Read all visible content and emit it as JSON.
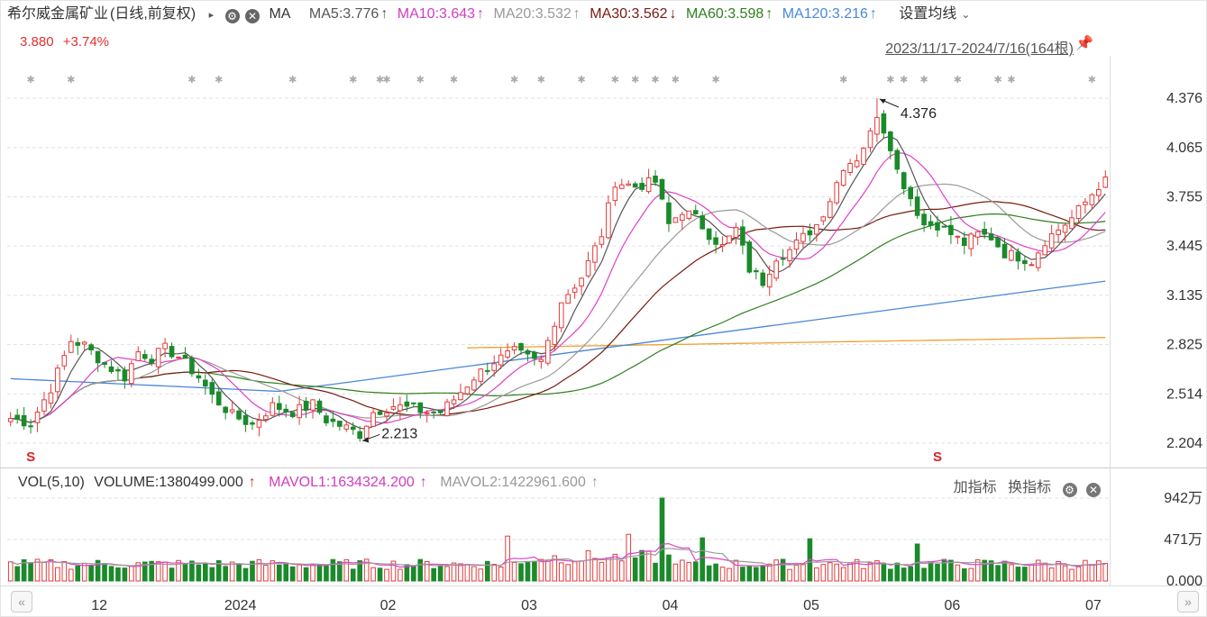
{
  "header": {
    "stock_name": "希尔威金属矿业",
    "period": "(日线,前复权)",
    "indicator": "MA",
    "ma5": "MA5:3.776",
    "ma5_arrow": "↑",
    "ma10": "MA10:3.643",
    "ma10_arrow": "↑",
    "ma20": "MA20:3.532",
    "ma20_arrow": "↑",
    "ma30": "MA30:3.562",
    "ma30_arrow": "↓",
    "ma60": "MA60:3.598",
    "ma60_arrow": "↑",
    "ma120": "MA120:3.216",
    "ma120_arrow": "↑",
    "settings_label": "设置均线"
  },
  "price_line": {
    "price": "3.880",
    "change": "+3.74%"
  },
  "date_range": "2023/11/17-2024/7/16(164根)",
  "volume_header": {
    "vol": "VOL(5,10)",
    "volume": "VOLUME:1380499.000",
    "volume_arrow": "↑",
    "mavol1": "MAVOL1:1634324.200",
    "mavol1_arrow": "↑",
    "mavol2": "MAVOL2:1422961.600",
    "mavol2_arrow": "↑",
    "add_indicator": "加指标",
    "switch_indicator": "换指标"
  },
  "colors": {
    "up": "#e23b3b",
    "down": "#1a8a2a",
    "ma5": "#555555",
    "ma10": "#e040c8",
    "ma20": "#9a9a9a",
    "ma30": "#7a1a10",
    "ma60": "#2f7f1f",
    "ma120": "#4a88d8",
    "ma250": "#f0a030"
  },
  "icons": {
    "settings": "gear-icon",
    "close": "close-icon",
    "pin": "pin-icon",
    "scroll_left": "chevron-left-icon",
    "scroll_right": "chevron-right-icon",
    "dropdown": "chevron-down-icon",
    "signal": "s-signal-icon"
  },
  "chart_data": {
    "type": "candlestick",
    "y_ticks": [
      "4.376",
      "4.065",
      "3.755",
      "3.445",
      "3.135",
      "2.825",
      "2.514",
      "2.204"
    ],
    "ylim": [
      2.204,
      4.376
    ],
    "x_labels": [
      "12",
      "2024",
      "02",
      "03",
      "04",
      "05",
      "06",
      "07"
    ],
    "annotations": {
      "high": "4.376",
      "low": "2.213"
    },
    "volume_ticks": [
      "942万",
      "471万",
      "0.000"
    ],
    "volume_max": 9420000,
    "grid": true,
    "price_waypoints": [
      [
        0,
        2.36
      ],
      [
        3,
        2.33
      ],
      [
        6,
        2.55
      ],
      [
        9,
        2.85
      ],
      [
        11,
        2.82
      ],
      [
        14,
        2.7
      ],
      [
        17,
        2.62
      ],
      [
        19,
        2.78
      ],
      [
        21,
        2.74
      ],
      [
        23,
        2.8
      ],
      [
        25,
        2.75
      ],
      [
        28,
        2.62
      ],
      [
        30,
        2.5
      ],
      [
        33,
        2.38
      ],
      [
        36,
        2.32
      ],
      [
        39,
        2.44
      ],
      [
        42,
        2.4
      ],
      [
        45,
        2.45
      ],
      [
        47,
        2.35
      ],
      [
        50,
        2.3
      ],
      [
        52,
        2.26
      ],
      [
        54,
        2.4
      ],
      [
        57,
        2.44
      ],
      [
        60,
        2.42
      ],
      [
        62,
        2.4
      ],
      [
        64,
        2.4
      ],
      [
        66,
        2.48
      ],
      [
        69,
        2.62
      ],
      [
        72,
        2.72
      ],
      [
        75,
        2.78
      ],
      [
        78,
        2.72
      ],
      [
        79,
        2.72
      ],
      [
        82,
        3.1
      ],
      [
        85,
        3.25
      ],
      [
        88,
        3.52
      ],
      [
        90,
        3.85
      ],
      [
        93,
        3.82
      ],
      [
        96,
        3.85
      ],
      [
        98,
        3.58
      ],
      [
        100,
        3.67
      ],
      [
        102,
        3.62
      ],
      [
        104,
        3.52
      ],
      [
        106,
        3.44
      ],
      [
        108,
        3.55
      ],
      [
        110,
        3.3
      ],
      [
        112,
        3.22
      ],
      [
        114,
        3.38
      ],
      [
        116,
        3.42
      ],
      [
        118,
        3.5
      ],
      [
        120,
        3.58
      ],
      [
        122,
        3.74
      ],
      [
        124,
        3.95
      ],
      [
        126,
        4.0
      ],
      [
        128,
        4.15
      ],
      [
        129,
        4.28
      ],
      [
        131,
        4.08
      ],
      [
        132,
        3.92
      ],
      [
        134,
        3.75
      ],
      [
        136,
        3.58
      ],
      [
        138,
        3.58
      ],
      [
        140,
        3.52
      ],
      [
        142,
        3.46
      ],
      [
        144,
        3.52
      ],
      [
        146,
        3.5
      ],
      [
        148,
        3.4
      ],
      [
        150,
        3.38
      ],
      [
        152,
        3.35
      ],
      [
        154,
        3.48
      ],
      [
        156,
        3.55
      ],
      [
        158,
        3.62
      ],
      [
        160,
        3.72
      ],
      [
        163,
        3.88
      ]
    ],
    "last_close": 3.88,
    "last_change_pct": 3.74,
    "candles_count": 164
  }
}
